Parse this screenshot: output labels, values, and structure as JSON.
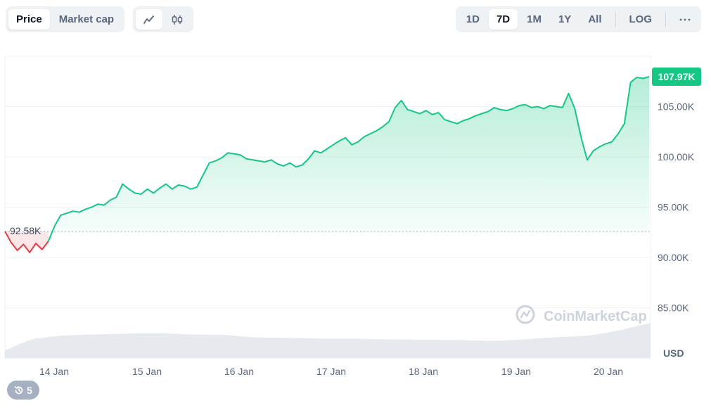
{
  "toolbar": {
    "view_tabs": [
      {
        "label": "Price",
        "active": true
      },
      {
        "label": "Market cap",
        "active": false
      }
    ],
    "chart_types": [
      {
        "icon": "line-chart-icon",
        "active": true
      },
      {
        "icon": "candlestick-icon",
        "active": false
      }
    ],
    "ranges": [
      {
        "label": "1D",
        "active": false
      },
      {
        "label": "7D",
        "active": true
      },
      {
        "label": "1M",
        "active": false
      },
      {
        "label": "1Y",
        "active": false
      },
      {
        "label": "All",
        "active": false
      }
    ],
    "log_label": "LOG",
    "more_icon": "more-horizontal-icon"
  },
  "chart_data": {
    "type": "area",
    "x_tick_labels": [
      "14 Jan",
      "15 Jan",
      "16 Jan",
      "17 Jan",
      "18 Jan",
      "19 Jan",
      "20 Jan"
    ],
    "y_tick_labels": [
      "105.00K",
      "100.00K",
      "95.00K",
      "90.00K",
      "85.00K"
    ],
    "y_ticks": [
      105000,
      100000,
      95000,
      90000,
      85000
    ],
    "ylim": [
      80000,
      110000
    ],
    "currency_label": "USD",
    "reference_price": 92580,
    "reference_label": "92.58K",
    "current_price": 107970,
    "current_label": "107.97K",
    "series": [
      {
        "values": [
          92600,
          91500,
          90700,
          91300,
          90500,
          91400,
          90800,
          91600,
          93100,
          94200,
          94400,
          94600,
          94500,
          94800,
          95000,
          95300,
          95200,
          95700,
          96000,
          97300,
          96800,
          96400,
          96300,
          96800,
          96400,
          96900,
          97300,
          96800,
          97200,
          97100,
          96800,
          97000,
          98200,
          99400,
          99600,
          99900,
          100400,
          100300,
          100200,
          99800,
          99700,
          99600,
          99500,
          99700,
          99300,
          99100,
          99400,
          99000,
          99200,
          99800,
          100600,
          100400,
          100800,
          101200,
          101600,
          101900,
          101200,
          101500,
          102000,
          102300,
          102600,
          103000,
          103500,
          104900,
          105600,
          104700,
          104500,
          104300,
          104600,
          104200,
          104400,
          103700,
          103500,
          103300,
          103600,
          103800,
          104100,
          104300,
          104500,
          104900,
          104700,
          104600,
          104800,
          105100,
          105200,
          104900,
          105000,
          104800,
          105100,
          105000,
          104900,
          106300,
          104800,
          102000,
          99700,
          100600,
          101000,
          101300,
          101500,
          102300,
          103300,
          107400,
          107900,
          107800,
          107970
        ]
      },
      {
        "name": "volume",
        "values": [
          22,
          40,
          55,
          60,
          64,
          66,
          67,
          68,
          69,
          70,
          70,
          70,
          68,
          67,
          66,
          66,
          62,
          59,
          58,
          58,
          57,
          56,
          55,
          55,
          55,
          54,
          53,
          53,
          52,
          52,
          51,
          51,
          50,
          49,
          50,
          52,
          55,
          58,
          60,
          62,
          65,
          72,
          80,
          90,
          100
        ]
      }
    ]
  },
  "watermark": "CoinMarketCap",
  "history": {
    "icon": "history-icon",
    "count": "5"
  },
  "colors": {
    "up": "#16c784",
    "down": "#ea3943",
    "axis_text": "#58667e",
    "grid": "#eff2f5",
    "volume": "#e6e9ee",
    "badge": "#a6b0c3"
  }
}
